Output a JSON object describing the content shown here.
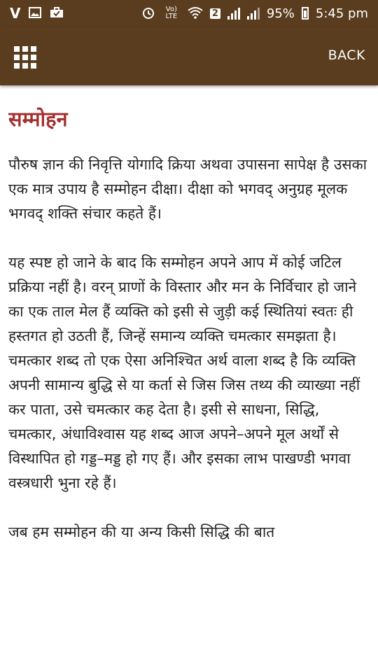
{
  "status_bar": {
    "carrier_icon": "V",
    "notification_icons": [
      "image-icon",
      "briefcase-icon"
    ],
    "alarm_icon": "alarm-icon",
    "volte_label": "Vo) LTE",
    "wifi_icon": "wifi-icon",
    "sim_number": "2",
    "battery_percent": "95%",
    "time": "5:45 pm"
  },
  "app_bar": {
    "menu_icon": "grid-menu-icon",
    "back_label": "BACK"
  },
  "article": {
    "title": "सम्मोहन",
    "paragraphs": [
      "पौरुष ज्ञान की निवृत्ति योगादि क्रिया अथवा उपासना सापेक्ष है उसका एक मात्र उपाय है सम्मोहन दीक्षा। दीक्षा को भगवद् अनुग्रह मूलक भगवद् शक्ति संचार कहते हैं।",
      "यह स्पष्ट हो जाने के बाद कि सम्मोहन अपने आप में कोई जटिल प्रक्रिया नहीं है। वरन् प्राणों के विस्तार और मन के निर्विचार हो जाने का एक ताल मेल हैं व्यक्ति को इसी से जुड़ी कई स्थितियां स्वतः ही हस्तगत हो उठती हैं, जिन्हें समान्य व्यक्ति चमत्कार समझता है। चमत्कार शब्द तो एक ऐसा अनिश्चित अर्थ वाला शब्द है कि व्यक्ति अपनी सामान्य बुद्धि से या कर्ता से जिस जिस तथ्य की व्याख्या नहीं कर पाता, उसे चमत्कार कह देता है। इसी से साधना, सिद्धि, चमत्कार, अंधाविश्वास यह शब्द आज अपने–अपने मूल अर्थों से विस्थापित हो गड्ड–मड्ड हो गए हैं। और इसका लाभ पाखण्डी भगवा वस्त्रधारी भुना रहे हैं।",
      "जब हम सम्मोहन की या अन्य किसी सिद्धि की बात"
    ]
  }
}
